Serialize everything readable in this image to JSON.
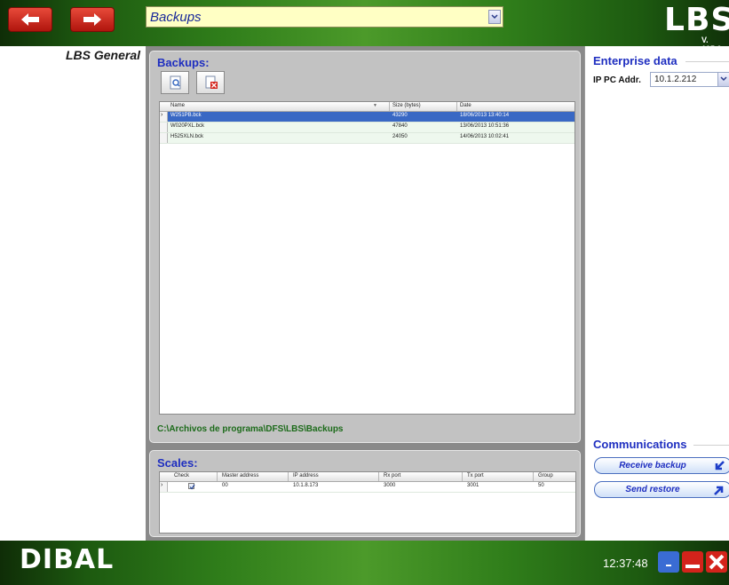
{
  "header": {
    "section_selected": "Backups",
    "logo_text": "LBS",
    "version": "V. 105.0"
  },
  "left_panel": {
    "title": "LBS General"
  },
  "backups": {
    "title": "Backups:",
    "columns": [
      "Name",
      "Size (bytes)",
      "Date"
    ],
    "rows": [
      {
        "name": "W251PB.bck",
        "size": "43290",
        "date": "18/06/2013 13:40:14",
        "selected": true
      },
      {
        "name": "W020PXL.bck",
        "size": "47840",
        "date": "13/06/2013 10:51:36",
        "selected": false
      },
      {
        "name": "H525XLN.bck",
        "size": "24050",
        "date": "14/06/2013 10:02:41",
        "selected": false
      }
    ],
    "path": "C:\\Archivos de programa\\DFS\\LBS\\Backups"
  },
  "scales": {
    "title": "Scales:",
    "columns": [
      "Check",
      "Master address",
      "IP address",
      "Rx port",
      "Tx port",
      "Group"
    ],
    "rows": [
      {
        "checked": true,
        "master_address": "00",
        "ip_address": "10.1.8.173",
        "rx_port": "3000",
        "tx_port": "3001",
        "group": "50"
      }
    ]
  },
  "enterprise": {
    "title": "Enterprise data",
    "ip_label": "IP PC Addr.",
    "ip_value": "10.1.2.212"
  },
  "communications": {
    "title": "Communications",
    "receive_label": "Receive backup",
    "send_label": "Send restore"
  },
  "footer": {
    "logo_text": "DIBAL",
    "clock": "12:37:48"
  },
  "colors": {
    "accent_blue": "#1e2ec0",
    "selection": "#3968c4",
    "path_green": "#1c6b1a",
    "close_red": "#d4231b"
  }
}
